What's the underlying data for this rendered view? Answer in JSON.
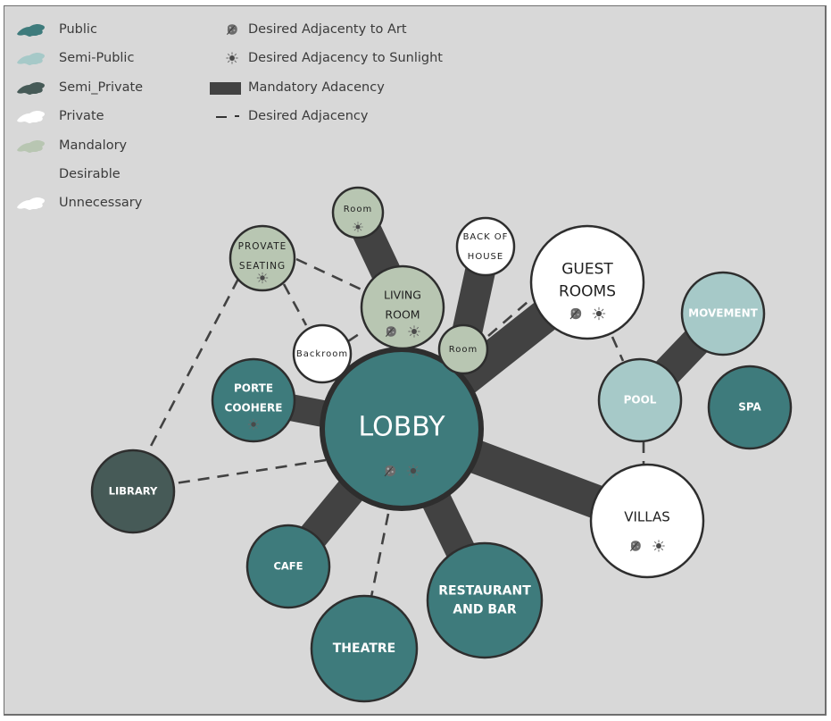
{
  "legend": {
    "zones": [
      {
        "label": "Public",
        "color": "#3e7b7c"
      },
      {
        "label": "Semi-Public",
        "color": "#a6c9c8"
      },
      {
        "label": "Semi_Private",
        "color": "#465a57"
      },
      {
        "label": "Private",
        "color": "#ffffff"
      },
      {
        "label": "Mandalory",
        "color": "#b8c6b2"
      },
      {
        "label": "Desirable",
        "color": null
      },
      {
        "label": "Unnecessary",
        "color": "#ffffff"
      }
    ],
    "symbols": [
      {
        "label": "Desired Adjacenty to Art",
        "icon": "art-icon"
      },
      {
        "label": "Desired Adjacency to Sunlight",
        "icon": "sun-icon"
      },
      {
        "label": "Mandatory Adacency",
        "icon": "mandatory-adjacency-bar"
      },
      {
        "label": "Desired Adjacency",
        "icon": "desired-adjacency-dash"
      }
    ]
  },
  "colors": {
    "public": "#3e7b7c",
    "semi_public": "#a6c9c8",
    "semi_private": "#465a57",
    "private": "#ffffff",
    "mandatory": "#b8c6b2",
    "connector": "#424242",
    "outline": "#2e2e2e",
    "background": "#d8d8d8"
  },
  "nodes": [
    {
      "id": "lobby",
      "lines": [
        "LOBBY"
      ],
      "zone": "public",
      "icons": [
        "art",
        "sun"
      ]
    },
    {
      "id": "guest-rooms",
      "lines": [
        "GUEST",
        "ROOMS"
      ],
      "zone": "private",
      "icons": [
        "art",
        "sun"
      ]
    },
    {
      "id": "living-room",
      "lines": [
        "LIVING",
        "ROOM"
      ],
      "zone": "mandatory",
      "icons": [
        "art",
        "sun"
      ]
    },
    {
      "id": "villas",
      "lines": [
        "VILLAS"
      ],
      "zone": "private",
      "icons": [
        "art",
        "sun"
      ]
    },
    {
      "id": "provate-seating",
      "lines": [
        "PROVATE",
        "SEATING"
      ],
      "zone": "mandatory",
      "icons": [
        "sun"
      ]
    },
    {
      "id": "room-top",
      "lines": [
        "Room"
      ],
      "zone": "mandatory",
      "icons": [
        "sun"
      ]
    },
    {
      "id": "back-of-house",
      "lines": [
        "BACK OF",
        "HOUSE"
      ],
      "zone": "private",
      "icons": []
    },
    {
      "id": "room-small",
      "lines": [
        "Room"
      ],
      "zone": "mandatory",
      "icons": []
    },
    {
      "id": "backroom",
      "lines": [
        "Backroom"
      ],
      "zone": "private",
      "icons": []
    },
    {
      "id": "porte-coohere",
      "lines": [
        "PORTE",
        "COOHERE"
      ],
      "zone": "public",
      "icons": [
        "sun"
      ]
    },
    {
      "id": "library",
      "lines": [
        "LIBRARY"
      ],
      "zone": "semi_private",
      "icons": []
    },
    {
      "id": "cafe",
      "lines": [
        "CAFE"
      ],
      "zone": "public",
      "icons": []
    },
    {
      "id": "theatre",
      "lines": [
        "THEATRE"
      ],
      "zone": "public",
      "icons": []
    },
    {
      "id": "restaurant-and-bar",
      "lines": [
        "RESTAURANT",
        "AND BAR"
      ],
      "zone": "public",
      "icons": []
    },
    {
      "id": "movement",
      "lines": [
        "MOVEMENT"
      ],
      "zone": "semi_public",
      "icons": []
    },
    {
      "id": "pool",
      "lines": [
        "POOL"
      ],
      "zone": "semi_public",
      "icons": []
    },
    {
      "id": "spa",
      "lines": [
        "SPA"
      ],
      "zone": "public",
      "icons": []
    }
  ],
  "connections": [
    {
      "from": "lobby",
      "to": "guest-rooms",
      "type": "mandatory"
    },
    {
      "from": "lobby",
      "to": "villas",
      "type": "mandatory"
    },
    {
      "from": "lobby",
      "to": "porte-coohere",
      "type": "mandatory"
    },
    {
      "from": "lobby",
      "to": "cafe",
      "type": "mandatory"
    },
    {
      "from": "lobby",
      "to": "restaurant-and-bar",
      "type": "mandatory"
    },
    {
      "from": "living-room",
      "to": "room-top",
      "type": "mandatory"
    },
    {
      "from": "room-small",
      "to": "back-of-house",
      "type": "mandatory"
    },
    {
      "from": "pool",
      "to": "movement",
      "type": "mandatory"
    },
    {
      "from": "lobby",
      "to": "theatre",
      "type": "desired"
    },
    {
      "from": "lobby",
      "to": "library",
      "type": "desired"
    },
    {
      "from": "provate-seating",
      "to": "library",
      "type": "desired"
    },
    {
      "from": "provate-seating",
      "to": "living-room",
      "type": "desired"
    },
    {
      "from": "provate-seating",
      "to": "backroom",
      "type": "desired"
    },
    {
      "from": "backroom",
      "to": "living-room",
      "type": "desired"
    },
    {
      "from": "room-small",
      "to": "guest-rooms",
      "type": "desired"
    },
    {
      "from": "guest-rooms",
      "to": "pool",
      "type": "desired"
    },
    {
      "from": "pool",
      "to": "villas",
      "type": "desired"
    }
  ]
}
